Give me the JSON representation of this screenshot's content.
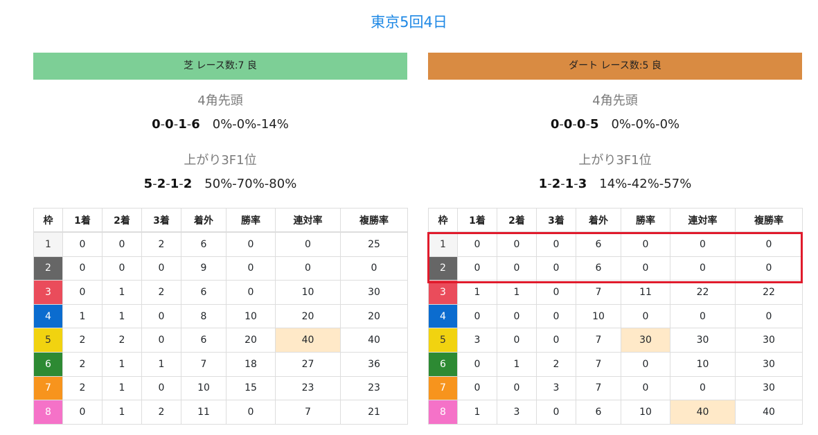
{
  "title": "東京5回4日",
  "colors": {
    "accent_blue": "#1e88e5",
    "turf_banner": "#7dcf96",
    "dirt_banner": "#d98b42",
    "highlight_cell": "#ffe9c8",
    "annotation_red": "#e01b2c"
  },
  "headers": [
    "枠",
    "1着",
    "2着",
    "3着",
    "着外",
    "勝率",
    "連対率",
    "複勝率"
  ],
  "waku_colors": [
    "#f5f5f5",
    "#666666",
    "#ea4c5b",
    "#0b6ccf",
    "#f1d310",
    "#2d8a33",
    "#f7941d",
    "#f572c8"
  ],
  "waku_text_colors": [
    "#333333",
    "#ffffff",
    "#ffffff",
    "#ffffff",
    "#333333",
    "#ffffff",
    "#ffffff",
    "#ffffff"
  ],
  "turf": {
    "banner": "芝 レース数:7 良",
    "label1": "4角先頭",
    "s1": {
      "a": "0",
      "b": "0",
      "c": "1",
      "d": "6",
      "pct": "0%-0%-14%"
    },
    "label2": "上がり3F1位",
    "s2": {
      "a": "5",
      "b": "2",
      "c": "1",
      "d": "2",
      "pct": "50%-70%-80%"
    },
    "rows": [
      [
        "1",
        "0",
        "0",
        "2",
        "6",
        "0",
        "0",
        "25"
      ],
      [
        "2",
        "0",
        "0",
        "0",
        "9",
        "0",
        "0",
        "0"
      ],
      [
        "3",
        "0",
        "1",
        "2",
        "6",
        "0",
        "10",
        "30"
      ],
      [
        "4",
        "1",
        "1",
        "0",
        "8",
        "10",
        "20",
        "20"
      ],
      [
        "5",
        "2",
        "2",
        "0",
        "6",
        "20",
        "40",
        "40"
      ],
      [
        "6",
        "2",
        "1",
        "1",
        "7",
        "18",
        "27",
        "36"
      ],
      [
        "7",
        "2",
        "1",
        "0",
        "10",
        "15",
        "23",
        "23"
      ],
      [
        "8",
        "0",
        "1",
        "2",
        "11",
        "0",
        "7",
        "21"
      ]
    ],
    "highlight": [
      [
        4,
        6
      ]
    ]
  },
  "dirt": {
    "banner": "ダート レース数:5 良",
    "label1": "4角先頭",
    "s1": {
      "a": "0",
      "b": "0",
      "c": "0",
      "d": "5",
      "pct": "0%-0%-0%"
    },
    "label2": "上がり3F1位",
    "s2": {
      "a": "1",
      "b": "2",
      "c": "1",
      "d": "3",
      "pct": "14%-42%-57%"
    },
    "rows": [
      [
        "1",
        "0",
        "0",
        "0",
        "6",
        "0",
        "0",
        "0"
      ],
      [
        "2",
        "0",
        "0",
        "0",
        "6",
        "0",
        "0",
        "0"
      ],
      [
        "3",
        "1",
        "1",
        "0",
        "7",
        "11",
        "22",
        "22"
      ],
      [
        "4",
        "0",
        "0",
        "0",
        "10",
        "0",
        "0",
        "0"
      ],
      [
        "5",
        "3",
        "0",
        "0",
        "7",
        "30",
        "30",
        "30"
      ],
      [
        "6",
        "0",
        "1",
        "2",
        "7",
        "0",
        "10",
        "30"
      ],
      [
        "7",
        "0",
        "0",
        "3",
        "7",
        "0",
        "0",
        "30"
      ],
      [
        "8",
        "1",
        "3",
        "0",
        "6",
        "10",
        "40",
        "40"
      ]
    ],
    "highlight": [
      [
        4,
        5
      ],
      [
        7,
        6
      ]
    ]
  }
}
